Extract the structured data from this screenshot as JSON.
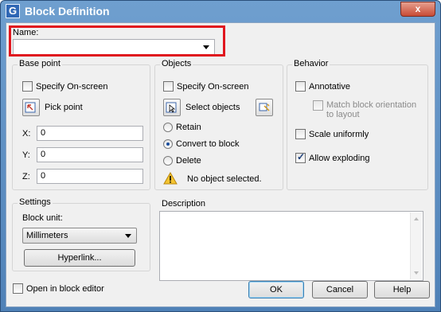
{
  "window": {
    "title": "Block Definition",
    "close_glyph": "x",
    "app_icon_glyph": "G"
  },
  "name": {
    "label": "Name:",
    "value": ""
  },
  "base_point": {
    "label": "Base point",
    "specify_on_screen": "Specify On-screen",
    "pick_point": "Pick point",
    "x_label": "X:",
    "x_value": "0",
    "y_label": "Y:",
    "y_value": "0",
    "z_label": "Z:",
    "z_value": "0"
  },
  "objects": {
    "label": "Objects",
    "specify_on_screen": "Specify On-screen",
    "select_objects": "Select objects",
    "retain": "Retain",
    "convert_to_block": "Convert to block",
    "delete": "Delete",
    "selected_option": "convert_to_block",
    "status": "No object selected."
  },
  "behavior": {
    "label": "Behavior",
    "annotative": "Annotative",
    "match_orientation_line1": "Match block orientation",
    "match_orientation_line2": "to layout",
    "scale_uniformly": "Scale uniformly",
    "allow_exploding": "Allow exploding",
    "allow_exploding_checked": true
  },
  "settings": {
    "label": "Settings",
    "block_unit_label": "Block unit:",
    "block_unit_value": "Millimeters",
    "hyperlink": "Hyperlink..."
  },
  "description": {
    "label": "Description",
    "value": ""
  },
  "footer": {
    "open_in_block_editor": "Open in block editor",
    "ok": "OK",
    "cancel": "Cancel",
    "help": "Help"
  },
  "colors": {
    "highlight": "#e0161e",
    "titlebar": "#5b8cc2"
  }
}
